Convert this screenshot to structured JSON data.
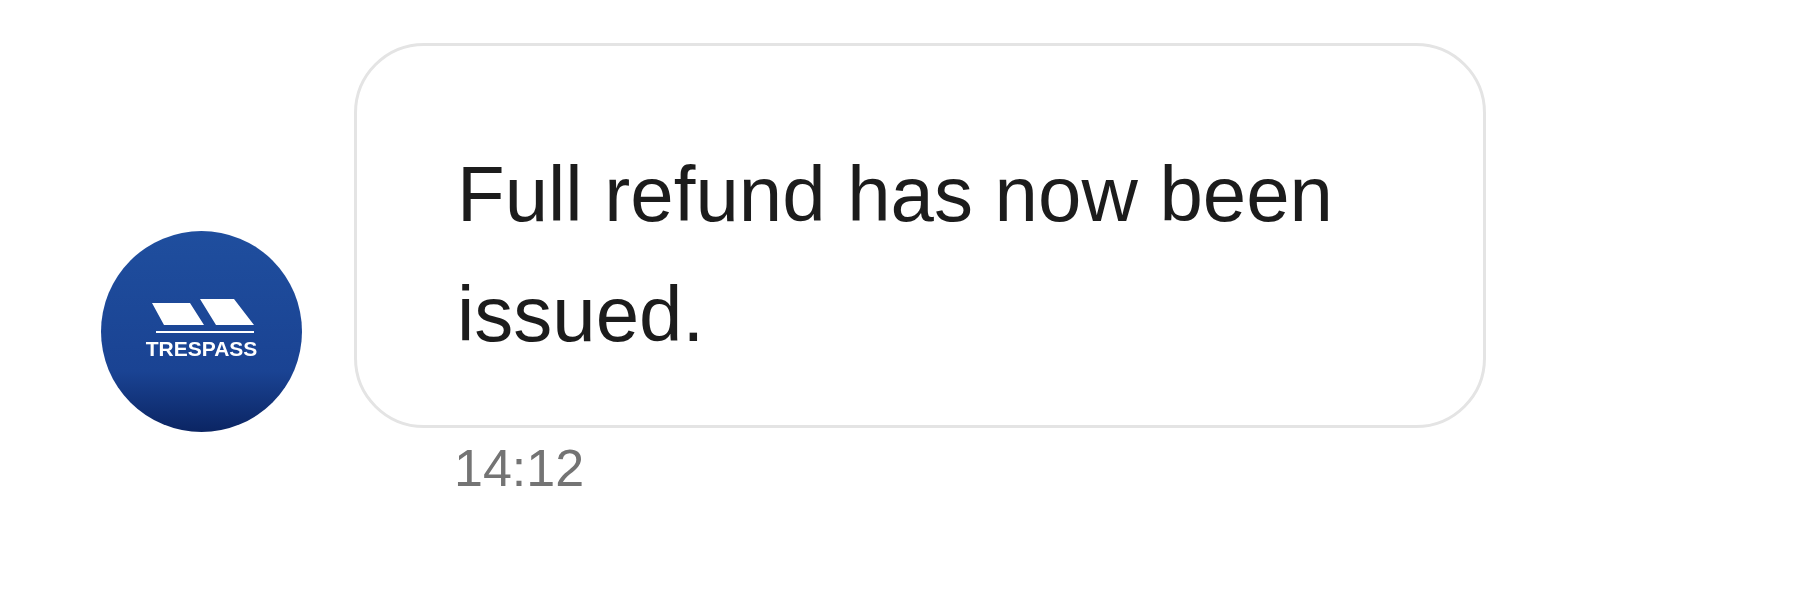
{
  "message": {
    "sender_logo_text": "TRESPASS",
    "text": "Full refund has now been issued.",
    "time": "14:12"
  }
}
